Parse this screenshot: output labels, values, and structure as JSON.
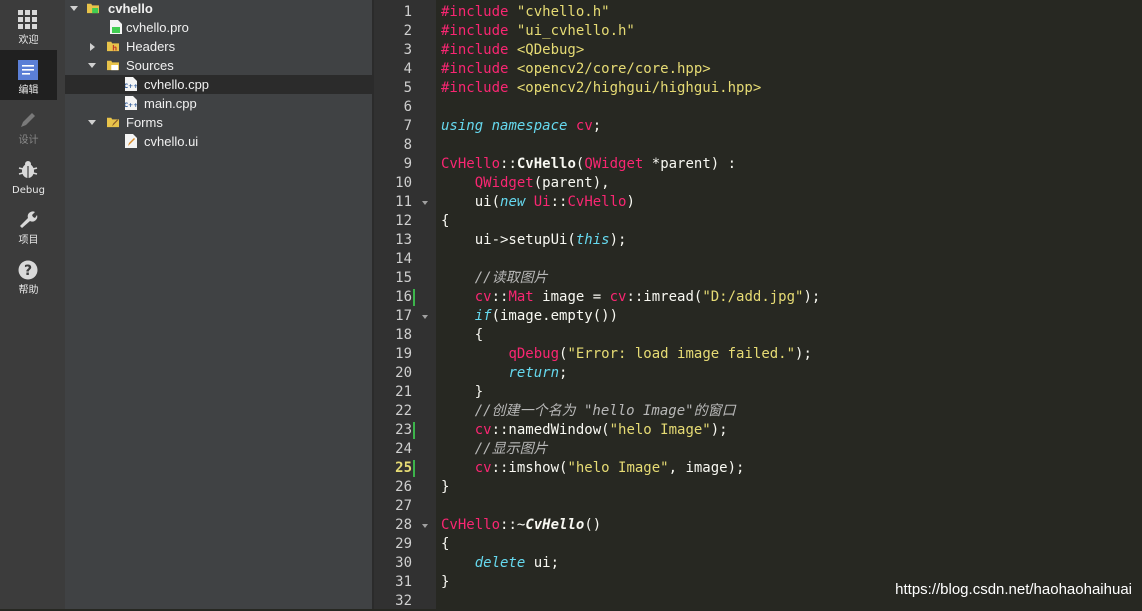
{
  "modes": [
    {
      "label": "欢迎",
      "icon": "grid-icon",
      "active": false,
      "disabled": false
    },
    {
      "label": "编辑",
      "icon": "edit-document-icon",
      "active": true,
      "disabled": false
    },
    {
      "label": "设计",
      "icon": "pencil-icon",
      "active": false,
      "disabled": true
    },
    {
      "label": "Debug",
      "icon": "bug-icon",
      "active": false,
      "disabled": false
    },
    {
      "label": "项目",
      "icon": "wrench-icon",
      "active": false,
      "disabled": false
    },
    {
      "label": "帮助",
      "icon": "help-icon",
      "active": false,
      "disabled": false
    }
  ],
  "tree": {
    "project": "cvhello",
    "pro_file": "cvhello.pro",
    "headers": "Headers",
    "sources": "Sources",
    "source_files": [
      "cvhello.cpp",
      "main.cpp"
    ],
    "forms": "Forms",
    "form_files": [
      "cvhello.ui"
    ]
  },
  "editor": {
    "current_line": 25,
    "lines": [
      [
        [
          "pp",
          "#include "
        ],
        [
          "str",
          "\"cvhello.h\""
        ]
      ],
      [
        [
          "pp",
          "#include "
        ],
        [
          "str",
          "\"ui_cvhello.h\""
        ]
      ],
      [
        [
          "pp",
          "#include "
        ],
        [
          "str",
          "<QDebug>"
        ]
      ],
      [
        [
          "pp",
          "#include "
        ],
        [
          "str",
          "<opencv2/core/core.hpp>"
        ]
      ],
      [
        [
          "pp",
          "#include "
        ],
        [
          "str",
          "<opencv2/highgui/highgui.hpp>"
        ]
      ],
      [],
      [
        [
          "kw",
          "using"
        ],
        [
          "",
          ""
        ],
        [
          "pl",
          " "
        ],
        [
          "kw",
          "namespace"
        ],
        [
          "pl",
          " "
        ],
        [
          "ty",
          "cv"
        ],
        [
          "pl",
          ";"
        ]
      ],
      [],
      [
        [
          "ty",
          "CvHello"
        ],
        [
          "pl",
          "::"
        ],
        [
          "fnb",
          "CvHello"
        ],
        [
          "pl",
          "("
        ],
        [
          "ty",
          "QWidget"
        ],
        [
          "pl",
          " *parent) :"
        ]
      ],
      [
        [
          "pl",
          "    "
        ],
        [
          "ty",
          "QWidget"
        ],
        [
          "pl",
          "(parent),"
        ]
      ],
      [
        [
          "pl",
          "    ui("
        ],
        [
          "kw",
          "new"
        ],
        [
          "pl",
          " "
        ],
        [
          "ty",
          "Ui"
        ],
        [
          "pl",
          "::"
        ],
        [
          "ty",
          "CvHello"
        ],
        [
          "pl",
          ")"
        ]
      ],
      [
        [
          "pl",
          "{"
        ]
      ],
      [
        [
          "pl",
          "    ui->setupUi("
        ],
        [
          "kw",
          "this"
        ],
        [
          "pl",
          ");"
        ]
      ],
      [],
      [
        [
          "cm",
          "    //读取图片"
        ]
      ],
      [
        [
          "pl",
          "    "
        ],
        [
          "ty",
          "cv"
        ],
        [
          "pl",
          "::"
        ],
        [
          "ty",
          "Mat"
        ],
        [
          "pl",
          " image = "
        ],
        [
          "ty",
          "cv"
        ],
        [
          "pl",
          "::imread("
        ],
        [
          "str",
          "\"D:/add.jpg\""
        ],
        [
          "pl",
          ");"
        ]
      ],
      [
        [
          "pl",
          "    "
        ],
        [
          "kw",
          "if"
        ],
        [
          "pl",
          "(image.empty())"
        ]
      ],
      [
        [
          "pl",
          "    {"
        ]
      ],
      [
        [
          "pl",
          "        "
        ],
        [
          "ty",
          "qDebug"
        ],
        [
          "pl",
          "("
        ],
        [
          "str",
          "\"Error: load image failed.\""
        ],
        [
          "pl",
          ");"
        ]
      ],
      [
        [
          "pl",
          "        "
        ],
        [
          "kw",
          "return"
        ],
        [
          "pl",
          ";"
        ]
      ],
      [
        [
          "pl",
          "    }"
        ]
      ],
      [
        [
          "cm",
          "    //创建一个名为 \"hello Image\"的窗口"
        ]
      ],
      [
        [
          "pl",
          "    "
        ],
        [
          "ty",
          "cv"
        ],
        [
          "pl",
          "::namedWindow("
        ],
        [
          "str",
          "\"helo Image\""
        ],
        [
          "pl",
          ");"
        ]
      ],
      [
        [
          "cm",
          "    //显示图片"
        ]
      ],
      [
        [
          "pl",
          "    "
        ],
        [
          "ty",
          "cv"
        ],
        [
          "pl",
          "::imshow("
        ],
        [
          "str",
          "\"helo Image\""
        ],
        [
          "pl",
          ", image);"
        ]
      ],
      [
        [
          "pl",
          "}"
        ]
      ],
      [],
      [
        [
          "ty",
          "CvHello"
        ],
        [
          "pl",
          "::~"
        ],
        [
          "fnbi",
          "CvHello"
        ],
        [
          "pl",
          "()"
        ]
      ],
      [
        [
          "pl",
          "{"
        ]
      ],
      [
        [
          "pl",
          "    "
        ],
        [
          "kw",
          "delete"
        ],
        [
          "pl",
          " ui;"
        ]
      ],
      [
        [
          "pl",
          "}"
        ]
      ],
      []
    ],
    "fold_lines": [
      11,
      17,
      28
    ],
    "changed_lines": [
      16,
      23,
      25
    ]
  },
  "watermark": "https://blog.csdn.net/haohaohaihuai",
  "colors": {
    "accent_keyword": "#66d9ef",
    "accent_string": "#e6db74",
    "accent_type": "#f92672",
    "change_marker": "#3cb44b"
  }
}
